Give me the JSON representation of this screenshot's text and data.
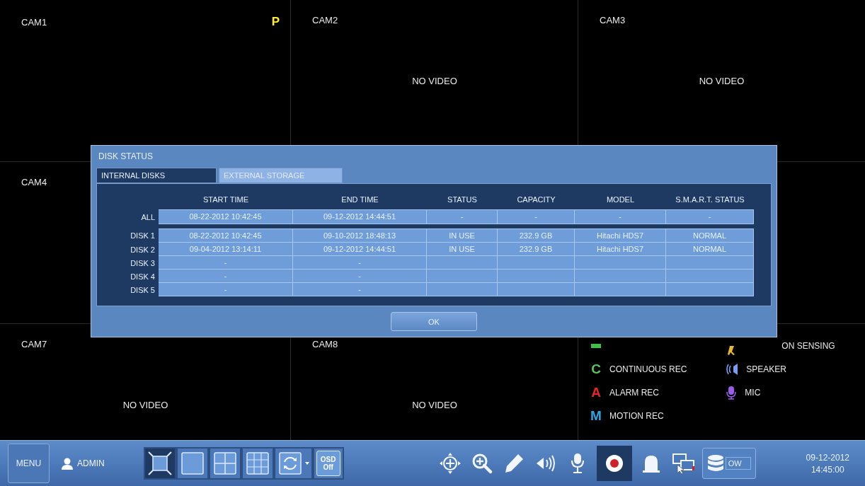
{
  "cameras": [
    {
      "kind": "camera",
      "label": "CAM1",
      "badge": "P"
    },
    {
      "kind": "camera",
      "label": "CAM2",
      "message": "NO VIDEO"
    },
    {
      "kind": "camera",
      "label": "CAM3",
      "message": "NO VIDEO"
    },
    {
      "kind": "camera",
      "label": "CAM4"
    },
    {
      "kind": "blank"
    },
    {
      "kind": "blank"
    },
    {
      "kind": "camera",
      "label": "CAM7",
      "message": "NO VIDEO"
    },
    {
      "kind": "camera",
      "label": "CAM8",
      "message": "NO VIDEO"
    },
    {
      "kind": "legend"
    }
  ],
  "legend": {
    "columns": [
      [
        {
          "kind": "bar",
          "color": "#3fc04a"
        },
        {
          "kind": "letter",
          "letter": "C",
          "color": "#5cc45c",
          "label": "CONTINUOUS REC"
        },
        {
          "kind": "letter",
          "letter": "A",
          "color": "#e8262a",
          "label": "ALARM REC"
        },
        {
          "kind": "letter",
          "letter": "M",
          "color": "#2aa8e8",
          "label": "MOTION REC"
        }
      ],
      [
        {
          "kind": "figure",
          "color": "#e8b830",
          "label": "ON SENSING"
        },
        {
          "kind": "speaker",
          "color": "#7a9cf0",
          "label": "SPEAKER"
        },
        {
          "kind": "mic",
          "color": "#9a5ce8",
          "label": "MIC"
        }
      ]
    ]
  },
  "dialog": {
    "title": "DISK STATUS",
    "tabs": [
      {
        "label": "INTERNAL DISKS",
        "selected": true
      },
      {
        "label": "EXTERNAL STORAGE",
        "selected": false
      }
    ],
    "columns": [
      "START TIME",
      "END TIME",
      "STATUS",
      "CAPACITY",
      "MODEL",
      "S.M.A.R.T. STATUS"
    ],
    "rows": [
      {
        "kind": "summary",
        "label": "ALL",
        "start": "08-22-2012  10:42:45",
        "end": "09-12-2012  14:44:51",
        "status": "-",
        "capacity": "-",
        "model": "-",
        "smart": "-"
      },
      {
        "kind": "disk",
        "label": "DISK 1",
        "start": "08-22-2012  10:42:45",
        "end": "09-10-2012  18:48:13",
        "status": "IN USE",
        "capacity": "232.9 GB",
        "model": "Hitachi HDS7",
        "smart": "NORMAL"
      },
      {
        "kind": "disk",
        "label": "DISK 2",
        "start": "09-04-2012  13:14:11",
        "end": "09-12-2012  14:44:51",
        "status": "IN USE",
        "capacity": "232.9 GB",
        "model": "Hitachi HDS7",
        "smart": "NORMAL"
      },
      {
        "kind": "disk",
        "label": "DISK 3",
        "start": "-",
        "end": "-"
      },
      {
        "kind": "disk",
        "label": "DISK 4",
        "start": "-",
        "end": "-"
      },
      {
        "kind": "disk",
        "label": "DISK 5",
        "start": "-",
        "end": "-"
      }
    ],
    "button": "OK"
  },
  "toolbar": {
    "menu": "MENU",
    "user": "ADMIN",
    "layouts": [
      {
        "kind": "fullscreen",
        "selected": true
      },
      {
        "kind": "single",
        "selected": false
      },
      {
        "kind": "quad",
        "selected": false
      },
      {
        "kind": "nine",
        "selected": false
      },
      {
        "kind": "sequence",
        "selected": false
      }
    ],
    "osd": [
      "OSD",
      "Off"
    ],
    "tools": [
      {
        "kind": "ptz",
        "selected": false
      },
      {
        "kind": "zoom",
        "selected": false
      },
      {
        "kind": "pen",
        "selected": false
      },
      {
        "kind": "speaker",
        "selected": false
      },
      {
        "kind": "mic",
        "selected": false
      },
      {
        "kind": "record",
        "selected": true
      },
      {
        "kind": "alarm",
        "selected": false
      },
      {
        "kind": "network",
        "selected": false
      }
    ],
    "storage": "OW",
    "date": "09-12-2012",
    "time": "14:45:00"
  }
}
